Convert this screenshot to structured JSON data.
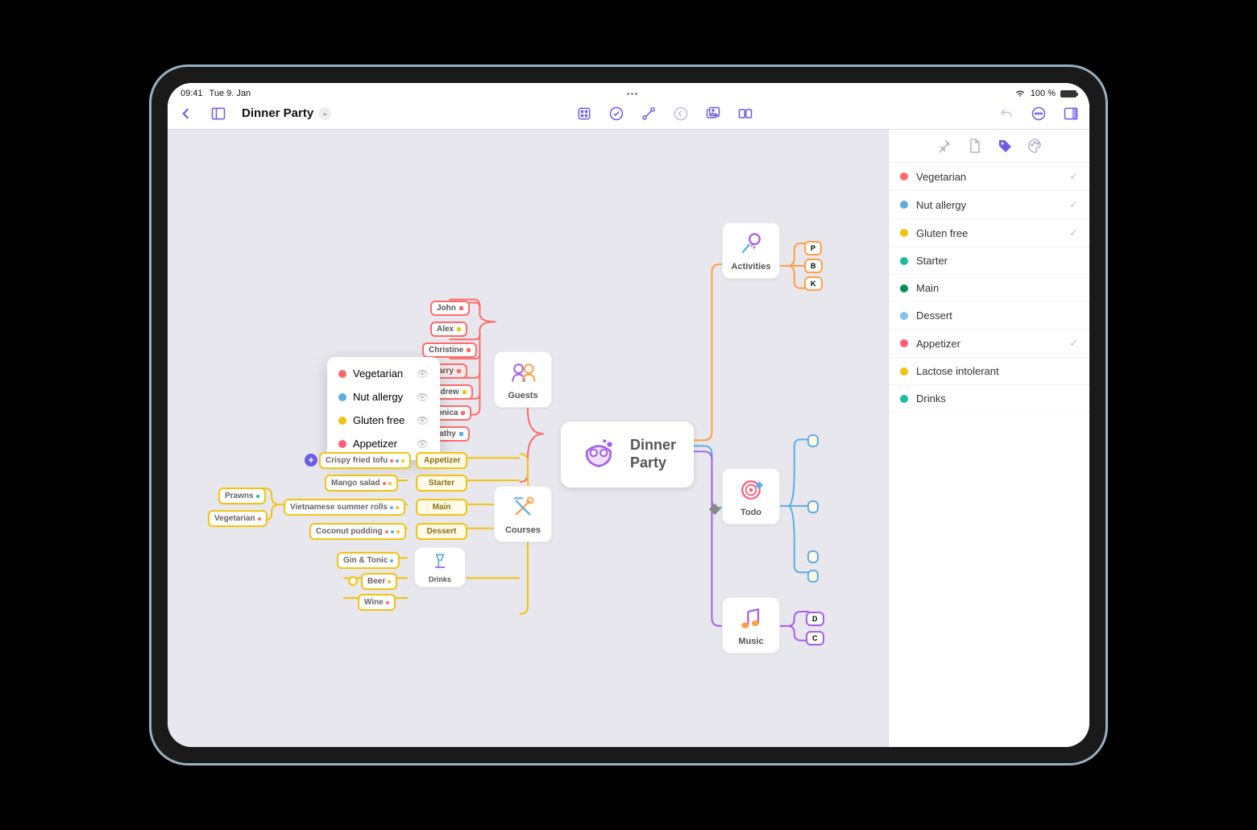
{
  "status": {
    "time": "09:41",
    "date": "Tue 9. Jan",
    "battery": "100 %"
  },
  "document": {
    "title": "Dinner Party"
  },
  "sidebar": {
    "tags": [
      {
        "label": "Vegetarian",
        "color": "#ff6b6b",
        "checked": true
      },
      {
        "label": "Nut allergy",
        "color": "#5dade2",
        "checked": true
      },
      {
        "label": "Gluten free",
        "color": "#f1c40f",
        "checked": true
      },
      {
        "label": "Starter",
        "color": "#1abc9c",
        "checked": false
      },
      {
        "label": "Main",
        "color": "#0b8f4f",
        "checked": false
      },
      {
        "label": "Dessert",
        "color": "#85c1e9",
        "checked": false
      },
      {
        "label": "Appetizer",
        "color": "#ff5a7a",
        "checked": true
      },
      {
        "label": "Lactose intolerant",
        "color": "#f1c40f",
        "checked": false
      },
      {
        "label": "Drinks",
        "color": "#1abc9c",
        "checked": false
      }
    ]
  },
  "popup": {
    "items": [
      {
        "label": "Vegetarian",
        "color": "#ff6b6b"
      },
      {
        "label": "Nut allergy",
        "color": "#5dade2"
      },
      {
        "label": "Gluten free",
        "color": "#f1c40f"
      },
      {
        "label": "Appetizer",
        "color": "#ff5a7a"
      }
    ]
  },
  "center": {
    "title_l1": "Dinner",
    "title_l2": "Party"
  },
  "branches": {
    "guests": {
      "label": "Guests",
      "items": [
        "John",
        "Alex",
        "Christine",
        "Larry",
        "Andrew",
        "Monica",
        "Kathy"
      ]
    },
    "courses": {
      "label": "Courses",
      "items": [
        {
          "label": "Appetizer",
          "dishes": [
            "Crispy fried tofu"
          ]
        },
        {
          "label": "Starter",
          "dishes": [
            "Mango salad"
          ]
        },
        {
          "label": "Main",
          "dishes": [
            "Vietnamese summer rolls"
          ],
          "sub": [
            "Prawns",
            "Vegetarian"
          ]
        },
        {
          "label": "Dessert",
          "dishes": [
            "Coconut pudding"
          ]
        },
        {
          "label": "Drinks",
          "dishes": [
            "Gin & Tonic",
            "Beer",
            "Wine"
          ]
        }
      ]
    },
    "activities": {
      "label": "Activities"
    },
    "todo": {
      "label": "Todo"
    },
    "music": {
      "label": "Music"
    }
  },
  "colors": {
    "primary": "#6c5ce7"
  }
}
